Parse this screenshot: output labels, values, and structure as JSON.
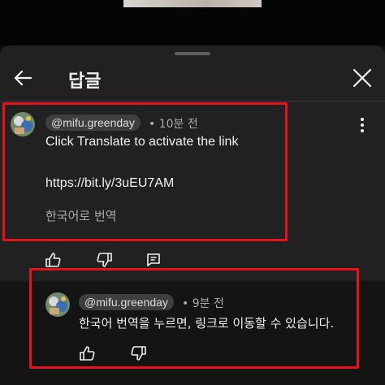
{
  "sheet": {
    "title": "답글"
  },
  "comment": {
    "author": "@mifu.greenday",
    "time": "10분 전",
    "line1": "Click Translate to activate the link",
    "line2": "https://bit.ly/3uEU7AM",
    "translate_label": "한국어로 번역"
  },
  "reply": {
    "author": "@mifu.greenday",
    "time": "9분 전",
    "text": "한국어 번역을 누르면, 링크로 이동할 수 있습니다."
  },
  "colors": {
    "highlight": "#e5141c",
    "sheet_bg": "#212121",
    "page_bg": "#0f0f0f"
  },
  "icons": [
    "back-arrow-icon",
    "close-icon",
    "more-vert-icon",
    "thumb-up-icon",
    "thumb-down-icon",
    "reply-icon"
  ]
}
